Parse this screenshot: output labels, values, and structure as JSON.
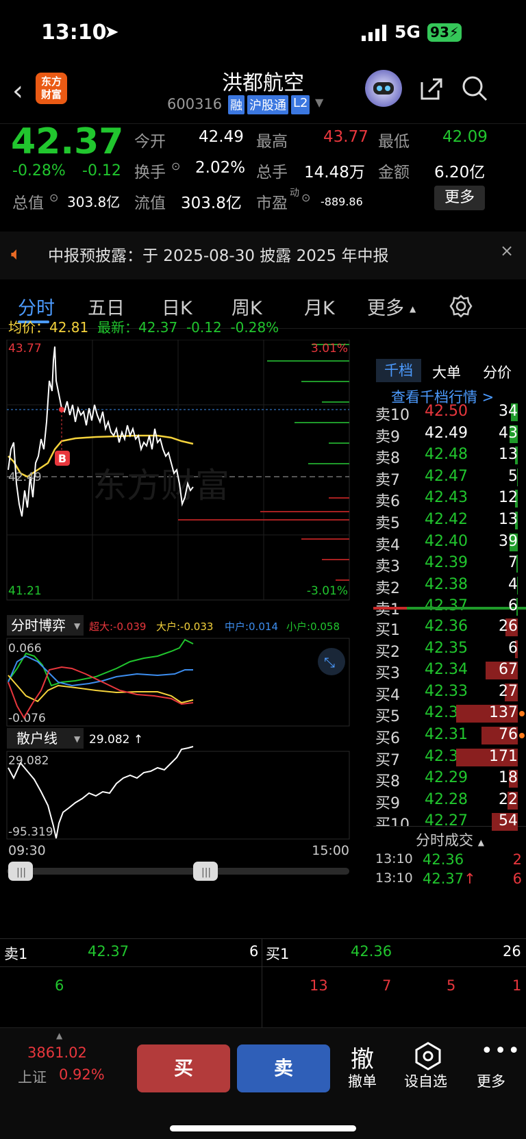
{
  "status": {
    "time": "13:10",
    "network": "5G",
    "battery": "93"
  },
  "header": {
    "title": "洪都航空",
    "code": "600316",
    "tags": [
      "融",
      "沪股通",
      "L2"
    ],
    "logo_line1": "东方",
    "logo_line2": "财富"
  },
  "quote": {
    "price": "42.37",
    "change_pct": "-0.28%",
    "change": "-0.12",
    "open_label": "今开",
    "open": "42.49",
    "high_label": "最高",
    "high": "43.77",
    "low_label": "最低",
    "low": "42.09",
    "turnover_label": "换手",
    "turnover": "2.02%",
    "vol_label": "总手",
    "vol": "14.48万",
    "amount_label": "金额",
    "amount": "6.20亿",
    "mcap_label": "总值",
    "mcap": "303.8亿",
    "float_label": "流值",
    "float": "303.8亿",
    "pe_label": "市盈",
    "pe_sup": "动",
    "pe": "-889.86",
    "more": "更多"
  },
  "notice": {
    "text": "中报预披露：于 2025-08-30 披露 2025 年中报"
  },
  "tabs": [
    "分时",
    "五日",
    "日K",
    "周K",
    "月K",
    "更多"
  ],
  "legend": {
    "avg_label": "均价：",
    "avg": "42.81",
    "last_label": "最新：",
    "last": "42.37",
    "chg": "-0.12",
    "pct": "-0.28%"
  },
  "chart": {
    "ymax": "43.77",
    "ymin": "41.21",
    "mid": "42.49",
    "pmax": "3.01%",
    "pmin": "-3.01%",
    "watermark": "东方财富",
    "marker": "B",
    "t_start": "09:30",
    "t_end": "15:00"
  },
  "game": {
    "title": "分时博弈",
    "super": "超大:-0.039",
    "big": "大户:-0.033",
    "mid": "中户:0.014",
    "small": "小户:0.058",
    "ymax": "0.066",
    "ymin": "-0.076"
  },
  "retail": {
    "title": "散户线",
    "value": "29.082 ↑",
    "ymax": "29.082",
    "ymin": "-95.319"
  },
  "book": {
    "tabs": [
      "千档",
      "大单",
      "分价"
    ],
    "link": "查看千档行情 >",
    "asks": [
      [
        "卖10",
        "42.50",
        "34",
        false,
        "red"
      ],
      [
        "卖9",
        "42.49",
        "43",
        false,
        "white"
      ],
      [
        "卖8",
        "42.48",
        "13",
        false,
        "green"
      ],
      [
        "卖7",
        "42.47",
        "5",
        false,
        "green"
      ],
      [
        "卖6",
        "42.43",
        "12",
        false,
        "green"
      ],
      [
        "卖5",
        "42.42",
        "13",
        false,
        "green"
      ],
      [
        "卖4",
        "42.40",
        "39",
        false,
        "green"
      ],
      [
        "卖3",
        "42.39",
        "7",
        false,
        "green"
      ],
      [
        "卖2",
        "42.38",
        "4",
        false,
        "green"
      ],
      [
        "卖1",
        "42.37",
        "6",
        false,
        "green"
      ]
    ],
    "bids": [
      [
        "买1",
        "42.36",
        "26",
        false,
        "green"
      ],
      [
        "买2",
        "42.35",
        "6",
        false,
        "green"
      ],
      [
        "买3",
        "42.34",
        "67",
        false,
        "green"
      ],
      [
        "买4",
        "42.33",
        "27",
        false,
        "green"
      ],
      [
        "买5",
        "42.32",
        "137",
        true,
        "green"
      ],
      [
        "买6",
        "42.31",
        "76",
        true,
        "green"
      ],
      [
        "买7",
        "42.30",
        "171",
        false,
        "green"
      ],
      [
        "买8",
        "42.29",
        "18",
        false,
        "green"
      ],
      [
        "买9",
        "42.28",
        "22",
        false,
        "green"
      ],
      [
        "买10",
        "42.27",
        "54",
        false,
        "green"
      ]
    ],
    "trades_title": "分时成交",
    "trades": [
      [
        "13:10",
        "42.36",
        "",
        "2"
      ],
      [
        "13:10",
        "42.37",
        "↑",
        "6"
      ]
    ]
  },
  "bottom_quote": {
    "ask_label": "卖1",
    "ask": "42.37",
    "ask_vol": "6",
    "bid_label": "买1",
    "bid": "42.36",
    "bid_vol": "26",
    "left_vals": [
      "6"
    ],
    "right_vals": [
      "13",
      "7",
      "5",
      "1"
    ]
  },
  "bottombar": {
    "index": "3861.02",
    "index_name": "上证",
    "index_pct": "0.92%",
    "buy": "买",
    "sell": "卖",
    "cancel_icon": "撤",
    "cancel": "撤单",
    "fav": "设自选",
    "more": "更多"
  }
}
